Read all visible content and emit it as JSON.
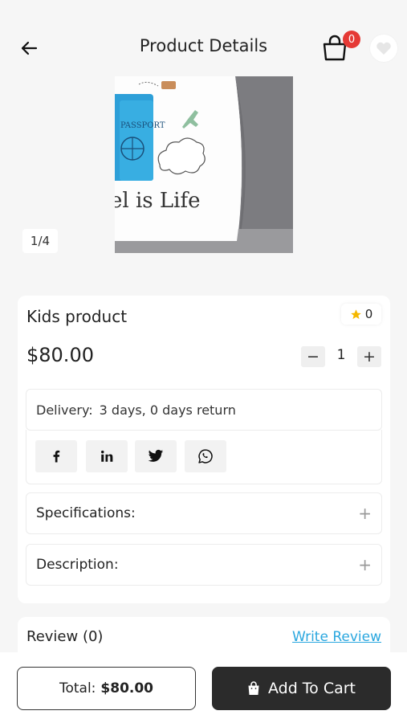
{
  "header": {
    "title": "Product Details",
    "cart_count": "0",
    "back_icon": "arrow-left-icon",
    "cart_icon": "shopping-bag-icon",
    "wishlist_icon": "heart-icon"
  },
  "gallery": {
    "image_counter": "1/4",
    "image_text": "el is Life",
    "passport_text": "PASSPORT"
  },
  "product": {
    "name": "Kids product",
    "rating": "0",
    "price": "$80.00",
    "quantity": "1",
    "qty_minus": "−",
    "qty_plus": "+"
  },
  "delivery": {
    "label": "Delivery:",
    "value": "3 days, 0 days return"
  },
  "social": [
    {
      "name": "facebook",
      "glyph": "f"
    },
    {
      "name": "linkedin",
      "glyph": "in"
    },
    {
      "name": "twitter",
      "glyph": "twitter-bird"
    },
    {
      "name": "whatsapp",
      "glyph": "whatsapp"
    }
  ],
  "sections": {
    "specifications": "Specifications:",
    "description": "Description:",
    "toggle": "+"
  },
  "review": {
    "title": "Review (0)",
    "write": "Write Review"
  },
  "footer": {
    "total_label": "Total:",
    "total_amount": "$80.00",
    "add_to_cart": "Add To Cart"
  },
  "colors": {
    "background": "#f6f6f6",
    "badge": "#e53935",
    "link": "#2aa7df",
    "cta": "#2b2b2b",
    "star": "#f5b800"
  }
}
